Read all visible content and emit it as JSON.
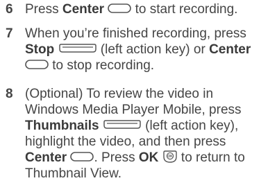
{
  "steps": [
    {
      "number": "6",
      "lines": [
        {
          "before": "Press ",
          "bold": "Center",
          "icon": "center-key",
          "after": " to start recording."
        }
      ]
    },
    {
      "number": "7",
      "lines": [
        {
          "text": "When you’re finished recording, press"
        },
        {
          "bold": "Stop",
          "icon": "left-action-key",
          "after": " (left action key) or ",
          "bold2": "Center"
        },
        {
          "icon": "center-key",
          "after": " to stop recording."
        }
      ]
    },
    {
      "number": "8",
      "lines": [
        {
          "text": "(Optional) To review the video in"
        },
        {
          "text": "Windows Media Player Mobile, press"
        },
        {
          "bold": "Thumbnails",
          "icon": "left-action-key",
          "after": " (left action key),"
        },
        {
          "text": "highlight the video, and then press"
        },
        {
          "bold": "Center",
          "icon": "center-key",
          "after": ". Press ",
          "bold2": "OK",
          "icon2": "ok-key",
          "after2": " to return to"
        },
        {
          "text": "Thumbnail View."
        }
      ]
    }
  ]
}
